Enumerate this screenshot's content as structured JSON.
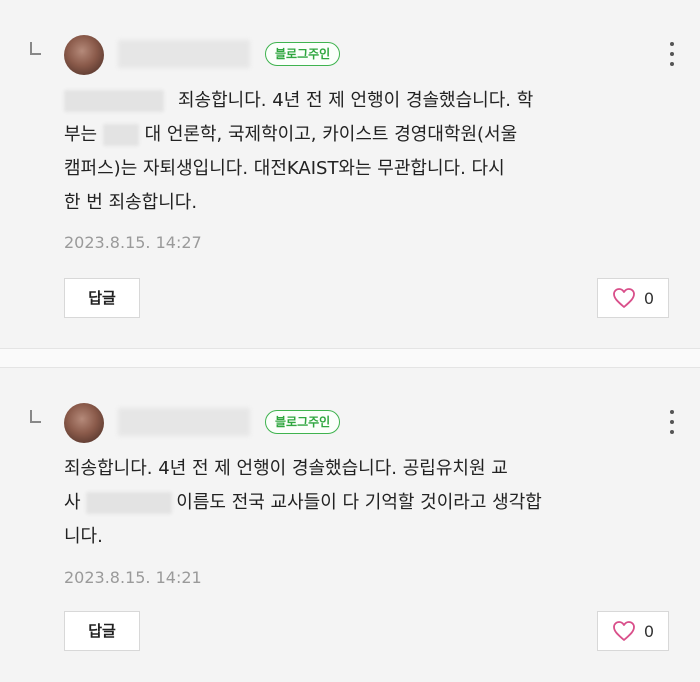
{
  "comments": [
    {
      "badge": "블로그주인",
      "line1": "죄송합니다. 4년 전 제 언행이 경솔했습니다. 학",
      "line2_a": "부는",
      "line2_b": "대 언론학, 국제학이고, 카이스트 경영대학원(서울",
      "line3": "캠퍼스)는 자퇴생입니다. 대전KAIST와는 무관합니다. 다시",
      "line4": "한 번 죄송합니다.",
      "timestamp": "2023.8.15. 14:27",
      "reply_label": "답글",
      "like_count": "0",
      "icons": {
        "more": "more-vertical-icon",
        "like": "heart-outline-icon"
      }
    },
    {
      "badge": "블로그주인",
      "line1": "죄송합니다. 4년 전 제 언행이 경솔했습니다. 공립유치원 교",
      "line2_a": "사",
      "line2_b": "이름도 전국 교사들이 다 기억할 것이라고 생각합",
      "line3": "니다.",
      "timestamp": "2023.8.15. 14:21",
      "reply_label": "답글",
      "like_count": "0",
      "icons": {
        "more": "more-vertical-icon",
        "like": "heart-outline-icon"
      }
    }
  ],
  "colors": {
    "badge_green": "#2fa63f",
    "heart": "#d94f8a",
    "background": "#f4f4f4"
  }
}
